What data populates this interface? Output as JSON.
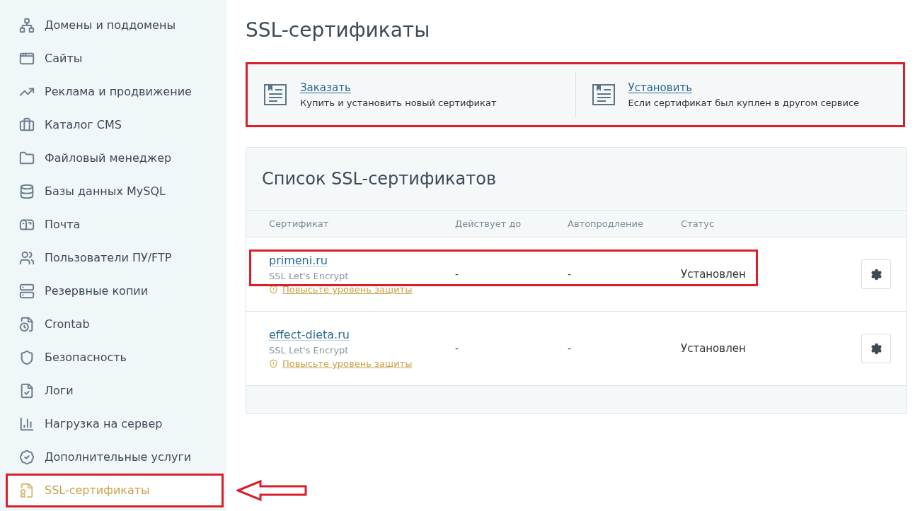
{
  "sidebar": {
    "items": [
      {
        "label": "Домены и поддомены",
        "selected": false,
        "highlighted": false,
        "pointer": false
      },
      {
        "label": "Сайты",
        "selected": false,
        "highlighted": false,
        "pointer": false
      },
      {
        "label": "Реклама и продвижение",
        "selected": false,
        "highlighted": false,
        "pointer": false
      },
      {
        "label": "Каталог CMS",
        "selected": false,
        "highlighted": false,
        "pointer": false
      },
      {
        "label": "Файловый менеджер",
        "selected": false,
        "highlighted": false,
        "pointer": false
      },
      {
        "label": "Базы данных MySQL",
        "selected": false,
        "highlighted": false,
        "pointer": false
      },
      {
        "label": "Почта",
        "selected": false,
        "highlighted": false,
        "pointer": false
      },
      {
        "label": "Пользователи ПУ/FTP",
        "selected": false,
        "highlighted": false,
        "pointer": false
      },
      {
        "label": "Резервные копии",
        "selected": false,
        "highlighted": false,
        "pointer": false
      },
      {
        "label": "Crontab",
        "selected": false,
        "highlighted": false,
        "pointer": false
      },
      {
        "label": "Безопасность",
        "selected": false,
        "highlighted": false,
        "pointer": false
      },
      {
        "label": "Логи",
        "selected": false,
        "highlighted": false,
        "pointer": false
      },
      {
        "label": "Нагрузка на сервер",
        "selected": false,
        "highlighted": false,
        "pointer": false
      },
      {
        "label": "Дополнительные услуги",
        "selected": false,
        "highlighted": false,
        "pointer": false
      },
      {
        "label": "SSL-сертификаты",
        "selected": true,
        "highlighted": true,
        "pointer": true
      }
    ]
  },
  "page_title": "SSL-сертификаты",
  "actions": {
    "highlighted": true,
    "items": [
      {
        "link": "Заказать",
        "description": "Купить и установить новый сертификат"
      },
      {
        "link": "Установить",
        "description": "Если сертификат был куплен в другом сервисе"
      }
    ]
  },
  "table": {
    "title": "Список SSL-сертификатов",
    "columns": [
      "Сертификат",
      "Действует до",
      "Автопродление",
      "Статус"
    ],
    "rows": [
      {
        "domain": "primeni.ru",
        "type": "SSL Let's Encrypt",
        "upgrade_link": "Повысьте уровень защиты",
        "valid_until": "-",
        "autorenew": "-",
        "status": "Установлен",
        "highlighted": true
      },
      {
        "domain": "effect-dieta.ru",
        "type": "SSL Let's Encrypt",
        "upgrade_link": "Повысьте уровень защиты",
        "valid_until": "-",
        "autorenew": "-",
        "status": "Установлен",
        "highlighted": false
      }
    ]
  }
}
